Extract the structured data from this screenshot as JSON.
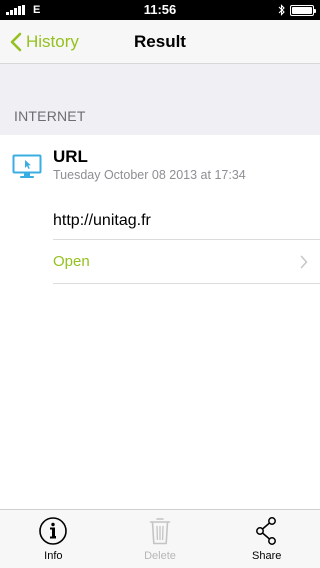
{
  "status_bar": {
    "carrier": "E",
    "time": "11:56"
  },
  "nav": {
    "back_label": "History",
    "title": "Result"
  },
  "section": {
    "header": "INTERNET"
  },
  "result": {
    "type_label": "URL",
    "date": "Tuesday October 08 2013 at 17:34",
    "value": "http://unitag.fr",
    "open_label": "Open",
    "icon": "monitor-cursor-icon"
  },
  "tab_bar": {
    "items": [
      {
        "label": "Info",
        "icon": "info-icon",
        "enabled": true
      },
      {
        "label": "Delete",
        "icon": "trash-icon",
        "enabled": false
      },
      {
        "label": "Share",
        "icon": "share-icon",
        "enabled": true
      }
    ]
  },
  "colors": {
    "accent": "#95c11f",
    "icon_blue": "#3aaee0",
    "disabled": "#b7b7b7",
    "section_bg": "#efeff4"
  }
}
